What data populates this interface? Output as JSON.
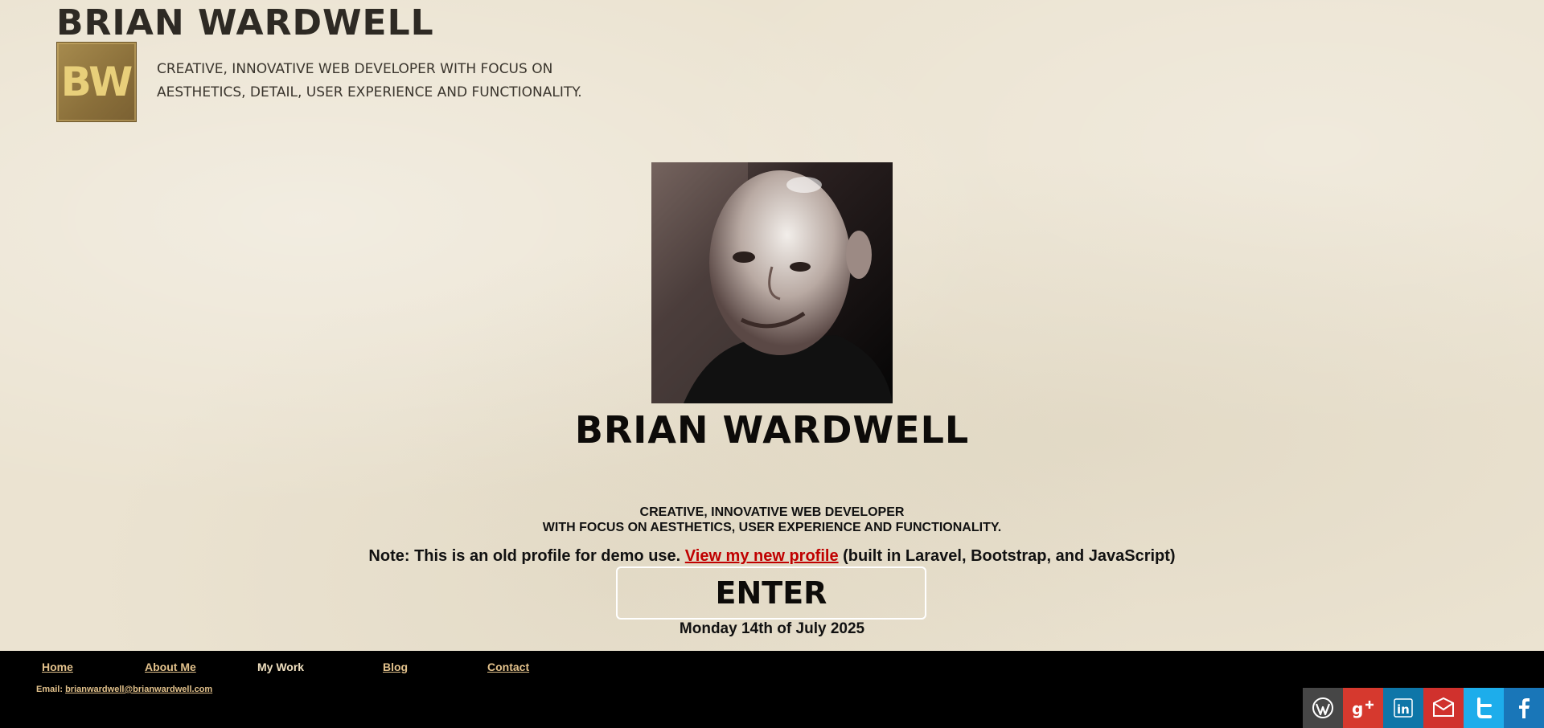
{
  "header": {
    "site_title": "BRIAN WARDWELL",
    "logo_text": "BW",
    "tagline": "CREATIVE, INNOVATIVE WEB DEVELOPER WITH FOCUS ON AESTHETICS, DETAIL, USER EXPERIENCE AND FUNCTIONALITY."
  },
  "hero": {
    "name": "BRIAN WARDWELL",
    "tagline_line1": "CREATIVE, INNOVATIVE WEB DEVELOPER",
    "tagline_line2": "WITH FOCUS ON AESTHETICS, USER EXPERIENCE AND FUNCTIONALITY.",
    "note_prefix": "Note: This is an old profile for demo use. ",
    "note_link": "View my new profile",
    "note_suffix": " (built in Laravel, Bootstrap, and JavaScript)",
    "enter_label": "ENTER",
    "date": "Monday 14th of July 2025"
  },
  "footer": {
    "nav": [
      {
        "label": "Home"
      },
      {
        "label": "About Me"
      },
      {
        "label": "My Work",
        "current": true
      },
      {
        "label": "Blog"
      },
      {
        "label": "Contact"
      }
    ],
    "email_label": "Email: ",
    "email": "brianwardwell@brianwardwell.com",
    "social": [
      {
        "icon": "wordpress-icon",
        "color": "#464646"
      },
      {
        "icon": "google-plus-icon",
        "color": "#d6392e"
      },
      {
        "icon": "linkedin-icon",
        "color": "#0e76a8"
      },
      {
        "icon": "mail-icon",
        "color": "#d0312d"
      },
      {
        "icon": "twitter-icon",
        "color": "#1dadeb"
      },
      {
        "icon": "facebook-icon",
        "color": "#1976b8"
      }
    ]
  }
}
